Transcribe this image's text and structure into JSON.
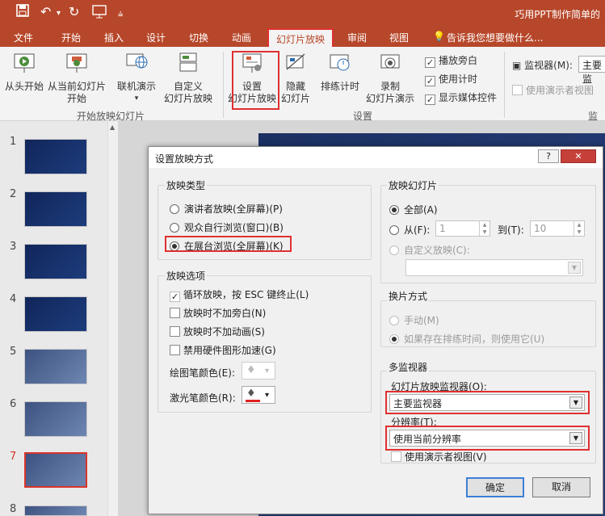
{
  "app": {
    "title": "巧用PPT制作简单的"
  },
  "tabs": [
    {
      "label": "文件"
    },
    {
      "label": "开始"
    },
    {
      "label": "插入"
    },
    {
      "label": "设计"
    },
    {
      "label": "切换"
    },
    {
      "label": "动画"
    },
    {
      "label": "幻灯片放映"
    },
    {
      "label": "审阅"
    },
    {
      "label": "视图"
    }
  ],
  "tell_me": "告诉我您想要做什么...",
  "ribbon": {
    "from_start": "从头开始",
    "from_current_1": "从当前幻灯片",
    "from_current_2": "开始",
    "online_present": "联机演示",
    "custom_1": "自定义",
    "custom_2": "幻灯片放映",
    "group_start": "开始放映幻灯片",
    "setup_1": "设置",
    "setup_2": "幻灯片放映",
    "hide_1": "隐藏",
    "hide_2": "幻灯片",
    "rehearse": "排练计时",
    "record_1": "录制",
    "record_2": "幻灯片演示",
    "play_narration": "播放旁白",
    "use_timings": "使用计时",
    "show_media": "显示媒体控件",
    "group_setup": "设置",
    "monitor_label": "监视器(M):",
    "monitor_value": "主要监",
    "presenter_view": "使用演示者视图",
    "group_monitor": "监视"
  },
  "slides": [
    {
      "num": "1"
    },
    {
      "num": "2"
    },
    {
      "num": "3"
    },
    {
      "num": "4"
    },
    {
      "num": "5"
    },
    {
      "num": "6"
    },
    {
      "num": "7"
    },
    {
      "num": "8"
    }
  ],
  "dialog": {
    "title": "设置放映方式",
    "help": "?",
    "close": "✕",
    "show_type": {
      "title": "放映类型",
      "options": [
        "演讲者放映(全屏幕)(P)",
        "观众自行浏览(窗口)(B)",
        "在展台浏览(全屏幕)(K)"
      ],
      "selected_index": 2
    },
    "show_options": {
      "title": "放映选项",
      "loop": "循环放映，按 ESC 键终止(L)",
      "no_narration": "放映时不加旁白(N)",
      "no_animation": "放映时不加动画(S)",
      "disable_hw": "禁用硬件图形加速(G)",
      "pen_color": "绘图笔颜色(E):",
      "laser_color": "激光笔颜色(R):"
    },
    "show_slides": {
      "title": "放映幻灯片",
      "all": "全部(A)",
      "from": "从(F):",
      "from_value": "1",
      "to": "到(T):",
      "to_value": "10",
      "custom": "自定义放映(C):"
    },
    "advance": {
      "title": "换片方式",
      "manual": "手动(M)",
      "timings": "如果存在排练时间，则使用它(U)"
    },
    "multi_monitor": {
      "title": "多监视器",
      "monitor_label": "幻灯片放映监视器(O):",
      "monitor_value": "主要监视器",
      "resolution_label": "分辨率(T):",
      "resolution_value": "使用当前分辨率",
      "presenter_view": "使用演示者视图(V)"
    },
    "ok": "确定",
    "cancel": "取消"
  },
  "colors": {
    "accent": "#b7472a",
    "highlight": "#e03030"
  }
}
